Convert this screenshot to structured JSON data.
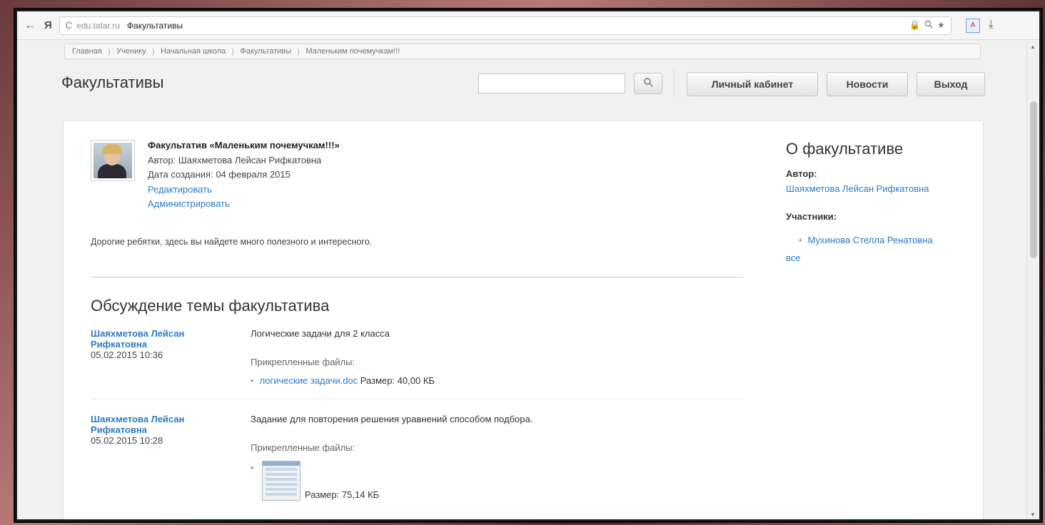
{
  "browser": {
    "domain": "edu.tatar.ru",
    "page_title": "Факультативы",
    "back_icon": "←",
    "yandex_icon": "Я",
    "reload_icon": "C"
  },
  "breadcrumb": {
    "items": [
      "Главная",
      "Ученику",
      "Начальная школа",
      "Факультативы",
      "Маленьким почемучкам!!!"
    ],
    "separator": "⟩"
  },
  "header": {
    "title": "Факультативы",
    "search_placeholder": "",
    "buttons": {
      "cabinet": "Личный кабинет",
      "news": "Новости",
      "exit": "Выход"
    }
  },
  "course": {
    "title": "Факультатив «Маленьким почемучкам!!!»",
    "author_line": "Автор: Шаяхметова Лейсан Рифкатовна",
    "created_line": "Дата создания: 04 февраля 2015",
    "edit_link": "Редактировать",
    "admin_link": "Администрировать",
    "description": "Дорогие ребятки, здесь вы найдете много полезного и интересного."
  },
  "discussion": {
    "title": "Обсуждение темы факультатива",
    "posts": [
      {
        "author": "Шаяхметова Лейсан Рифкатовна",
        "author_line1": "Шаяхметова Лейсан",
        "author_line2": "Рифкатовна",
        "date": "05.02.2015 10:36",
        "text": "Логические задачи для 2 класса",
        "files_label": "Прикрепленные файлы:",
        "file_name": "логические задачи.doc",
        "file_size": "Размер: 40,00 КБ"
      },
      {
        "author_line1": "Шаяхметова Лейсан",
        "author_line2": "Рифкатовна",
        "date": "05.02.2015 10:28",
        "text": "Задание для повторения решения уравнений способом подбора.",
        "files_label": "Прикрепленные файлы:",
        "file_size": "Размер: 75,14 КБ"
      }
    ]
  },
  "sidebar": {
    "title": "О факультативе",
    "author_label": "Автор:",
    "author_name": "Шаяхметова Лейсан Рифкатовна",
    "members_label": "Участники:",
    "members": [
      "Мухинова Стелла Ренатовна"
    ],
    "all_link": "все"
  }
}
